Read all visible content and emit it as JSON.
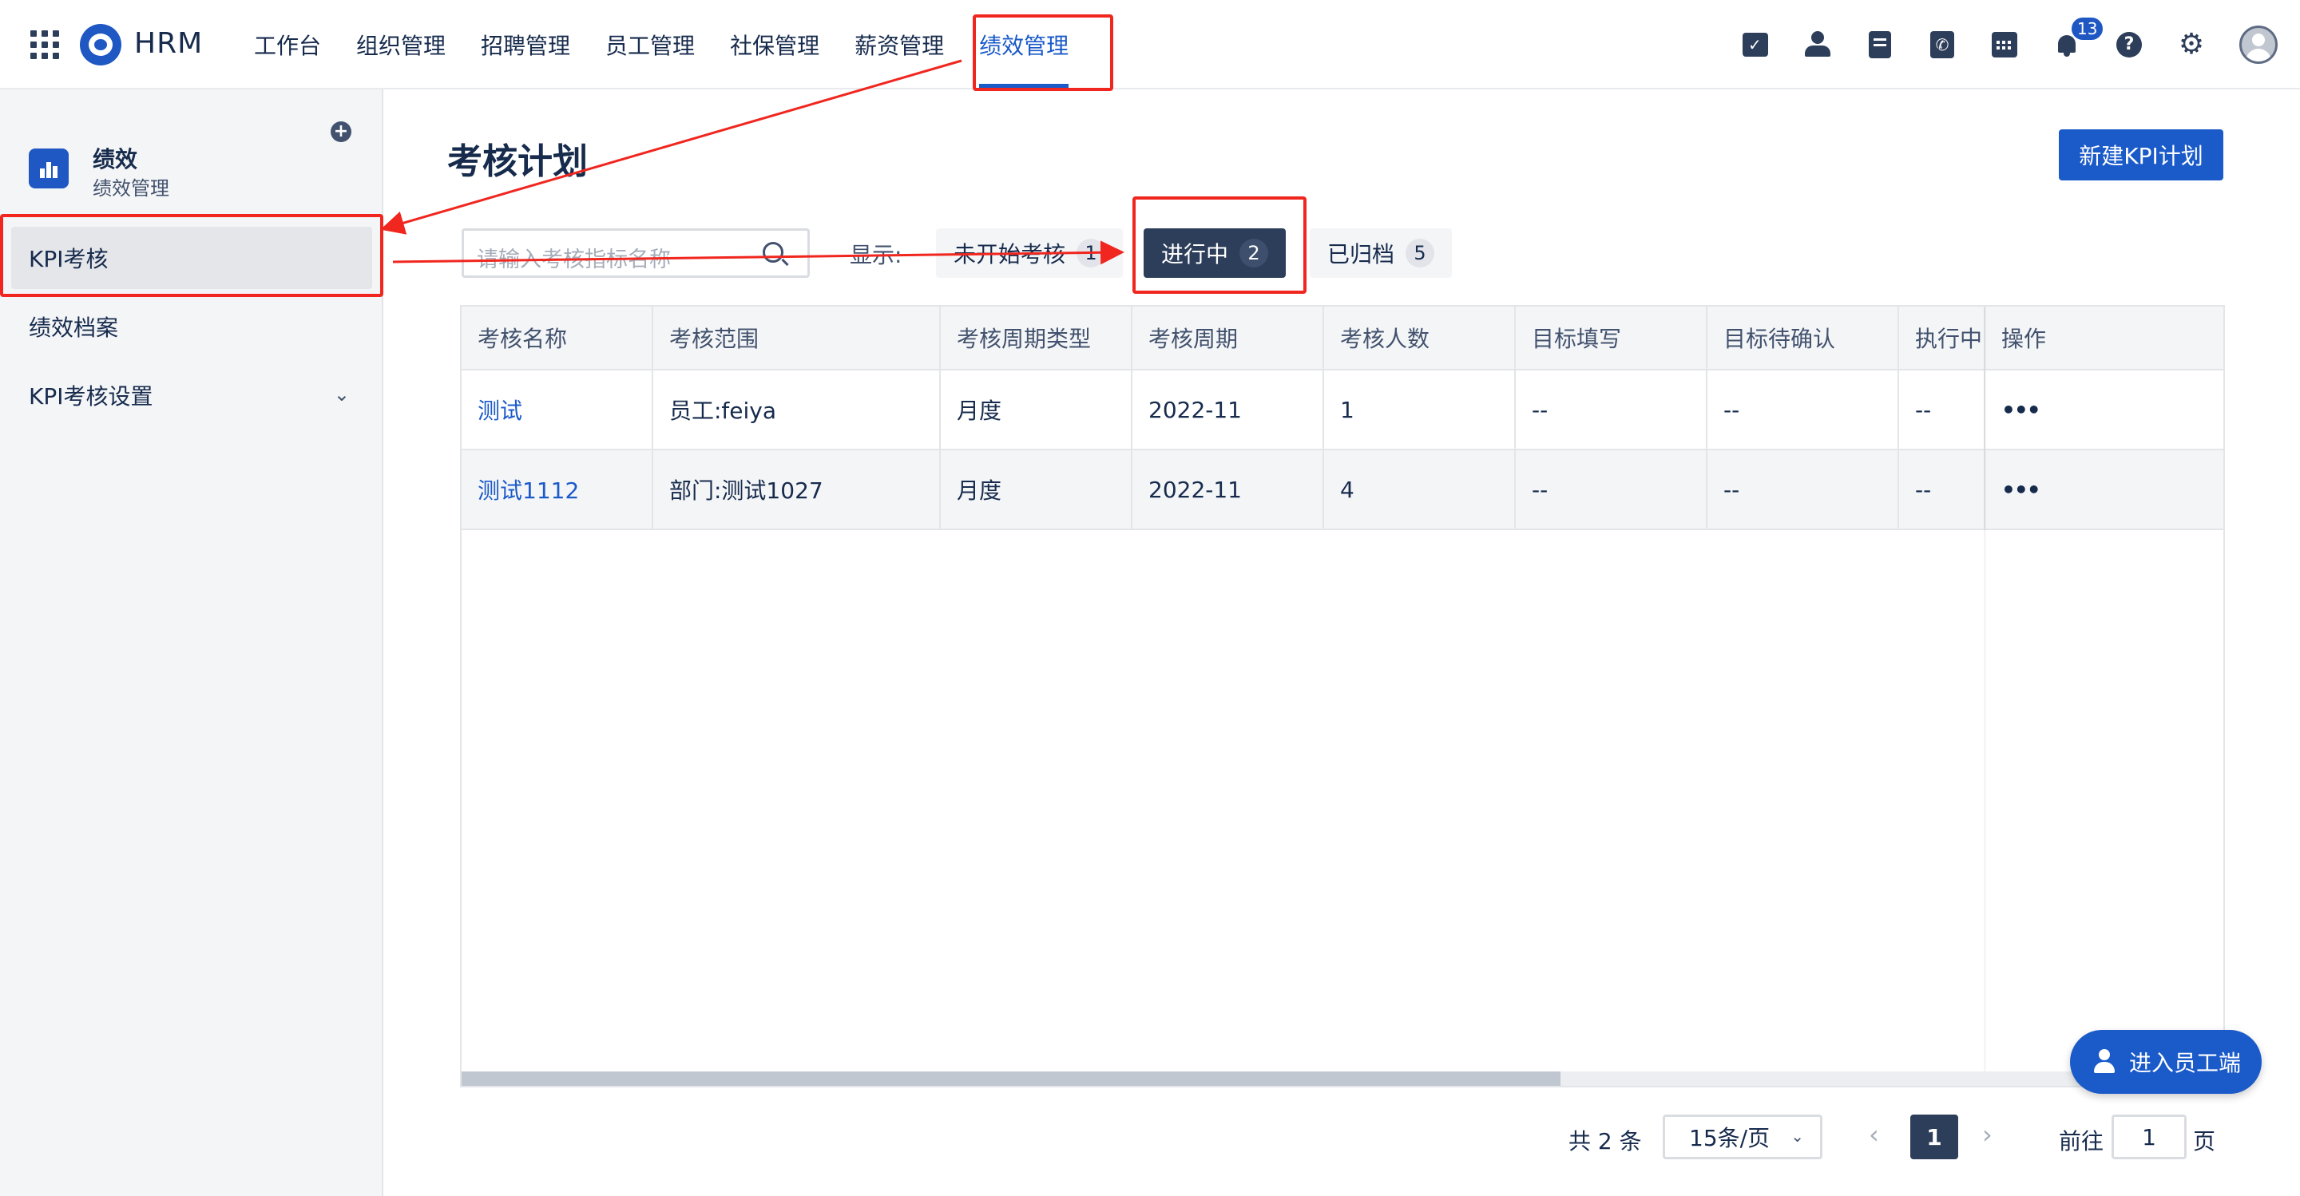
{
  "app": {
    "brand": "HRM"
  },
  "nav": {
    "items": [
      {
        "label": "工作台"
      },
      {
        "label": "组织管理"
      },
      {
        "label": "招聘管理"
      },
      {
        "label": "员工管理"
      },
      {
        "label": "社保管理"
      },
      {
        "label": "薪资管理"
      },
      {
        "label": "绩效管理",
        "active": true
      }
    ]
  },
  "header": {
    "notifications_count": "13",
    "icons": [
      "calendar-check-icon",
      "user-icon",
      "document-icon",
      "phone-icon",
      "schedule-icon",
      "bell-icon",
      "help-icon",
      "gear-icon",
      "avatar"
    ]
  },
  "sidebar": {
    "title": "绩效",
    "subtitle": "绩效管理",
    "items": [
      {
        "label": "KPI考核",
        "active": true
      },
      {
        "label": "绩效档案"
      },
      {
        "label": "KPI考核设置",
        "has_children": true
      }
    ]
  },
  "main": {
    "title": "考核计划",
    "new_button": "新建KPI计划",
    "search": {
      "placeholder": "请输入考核指标名称",
      "value": ""
    },
    "filter": {
      "label": "显示:",
      "options": [
        {
          "label": "未开始考核",
          "count": "1"
        },
        {
          "label": "进行中",
          "count": "2",
          "active": true
        },
        {
          "label": "已归档",
          "count": "5"
        }
      ]
    },
    "table": {
      "columns": [
        "考核名称",
        "考核范围",
        "考核周期类型",
        "考核周期",
        "考核人数",
        "目标填写",
        "目标待确认",
        "执行中",
        "操作"
      ],
      "rows": [
        [
          "测试",
          "员工:feiya",
          "月度",
          "2022-11",
          "1",
          "--",
          "--",
          "--",
          "•••"
        ],
        [
          "测试1112",
          "部门:测试1027",
          "月度",
          "2022-11",
          "4",
          "--",
          "--",
          "--",
          "•••"
        ]
      ]
    },
    "pagination": {
      "total": "共 2 条",
      "page_size": "15条/页",
      "prev": "‹",
      "current_page": "1",
      "next": "›",
      "goto_label": "前往",
      "goto_value": "1",
      "unit": "页"
    }
  },
  "fab": {
    "label": "进入员工端"
  },
  "colors": {
    "accent": "#1a5ac9",
    "dark": "#2d3e5a",
    "annotation": "#f0261f"
  }
}
